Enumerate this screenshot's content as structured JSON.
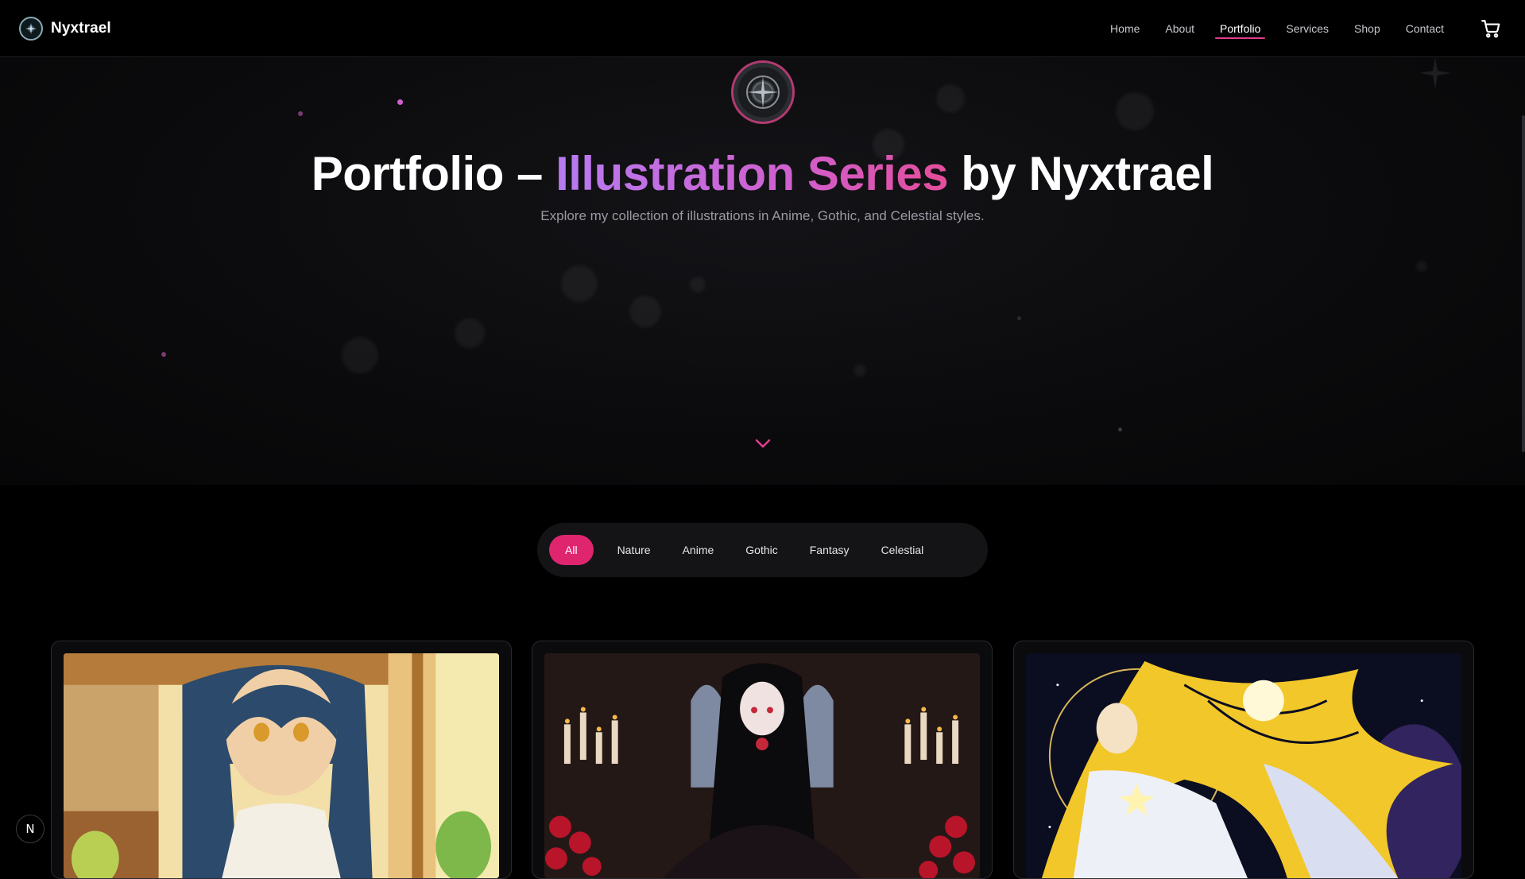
{
  "brand": {
    "name": "Nyxtrael"
  },
  "nav": {
    "items": [
      {
        "label": "Home"
      },
      {
        "label": "About"
      },
      {
        "label": "Portfolio",
        "active": true
      },
      {
        "label": "Services"
      },
      {
        "label": "Shop"
      },
      {
        "label": "Contact"
      }
    ],
    "cart_icon": "cart-icon"
  },
  "hero": {
    "title_prefix": "Portfolio – ",
    "title_highlight": "Illustration Series",
    "title_suffix": " by Nyxtrael",
    "subtitle": "Explore my collection of illustrations in Anime, Gothic, and Celestial styles.",
    "scroll_icon": "chevron-down-icon"
  },
  "filters": {
    "items": [
      {
        "label": "All",
        "active": true
      },
      {
        "label": "Nature"
      },
      {
        "label": "Anime"
      },
      {
        "label": "Gothic"
      },
      {
        "label": "Fantasy"
      },
      {
        "label": "Celestial"
      }
    ]
  },
  "gallery": {
    "cards": [
      {
        "style": "anime",
        "subject": "blue-haired anime girl by a sunlit window"
      },
      {
        "style": "gothic",
        "subject": "gothic girl in black dress with candles and red roses"
      },
      {
        "style": "celestial",
        "subject": "golden-haired celestial goddess with sun orb"
      }
    ]
  },
  "colors": {
    "accent": "#e0256f",
    "gradient_start": "#b77bf0",
    "gradient_end": "#e44d9a",
    "background": "#000000"
  },
  "dev_badge": {
    "label": "N"
  }
}
